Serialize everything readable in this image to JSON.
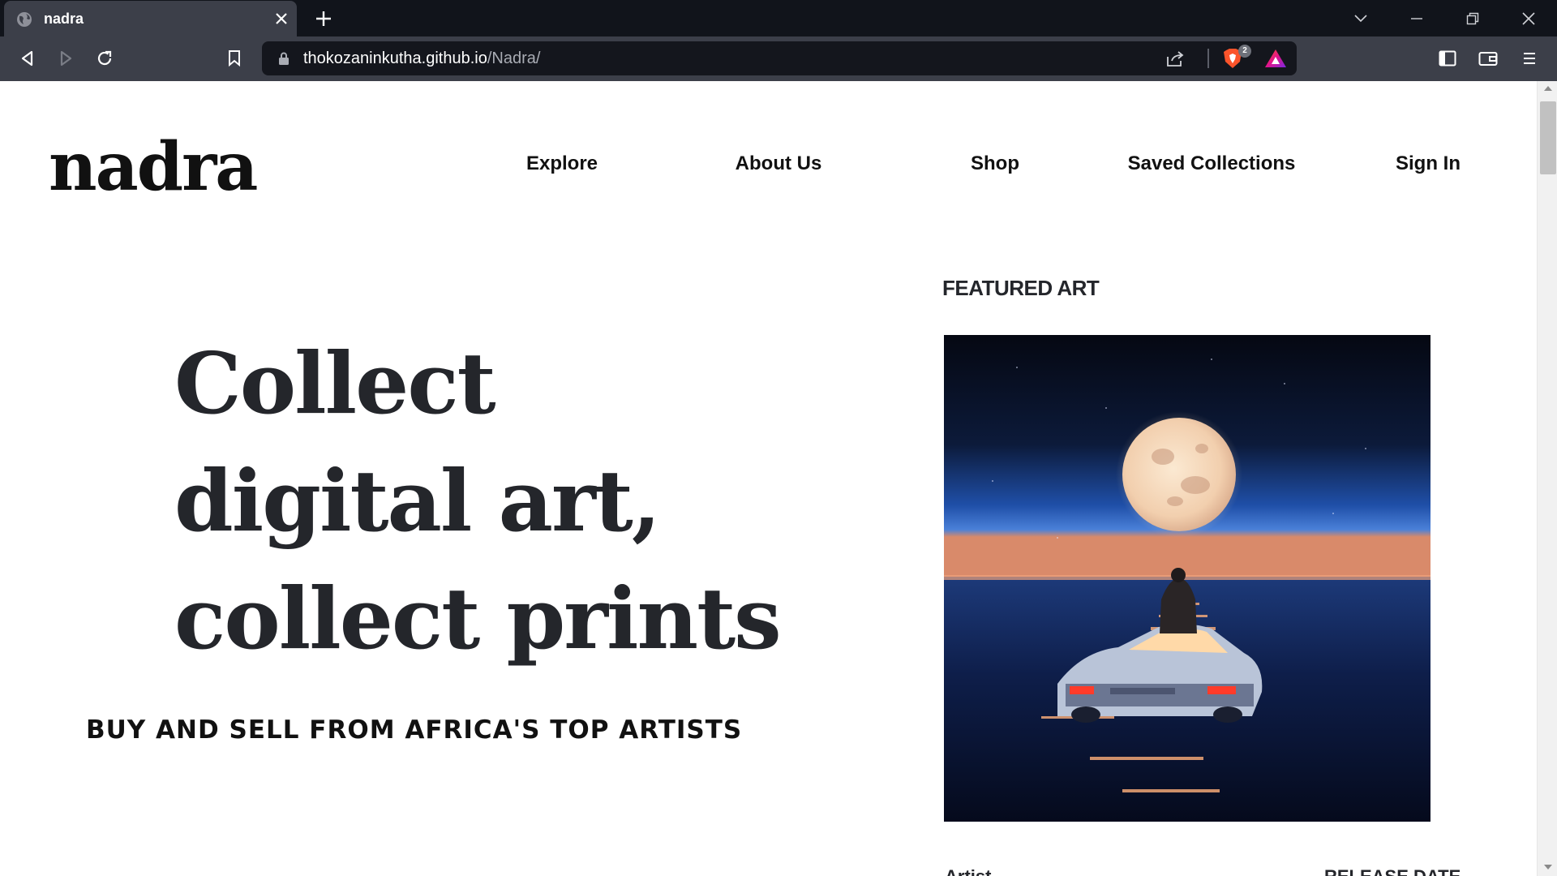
{
  "browser": {
    "tab_title": "nadra",
    "url_host": "thokozaninkutha.github.io",
    "url_path": "/Nadra/",
    "shields_count": "2"
  },
  "site": {
    "logo": "nadra",
    "nav": [
      {
        "label": "Explore"
      },
      {
        "label": "About Us"
      },
      {
        "label": "Shop"
      },
      {
        "label": "Saved Collections"
      },
      {
        "label": "Sign In"
      }
    ]
  },
  "hero": {
    "title": "Collect digital art, collect prints",
    "subtitle": "BUY AND SELL FROM AFRICA'S TOP ARTISTS"
  },
  "featured": {
    "label": "FEATURED ART",
    "artwork": "moon-over-ocean-car-artwork",
    "below_left": "Artist",
    "below_right": "RELEASE DATE"
  },
  "colors": {
    "chrome_dark": "#11141b",
    "chrome_toolbar": "#3c3f49",
    "text_dark": "#24262b",
    "brave_orange": "#fb542b"
  }
}
